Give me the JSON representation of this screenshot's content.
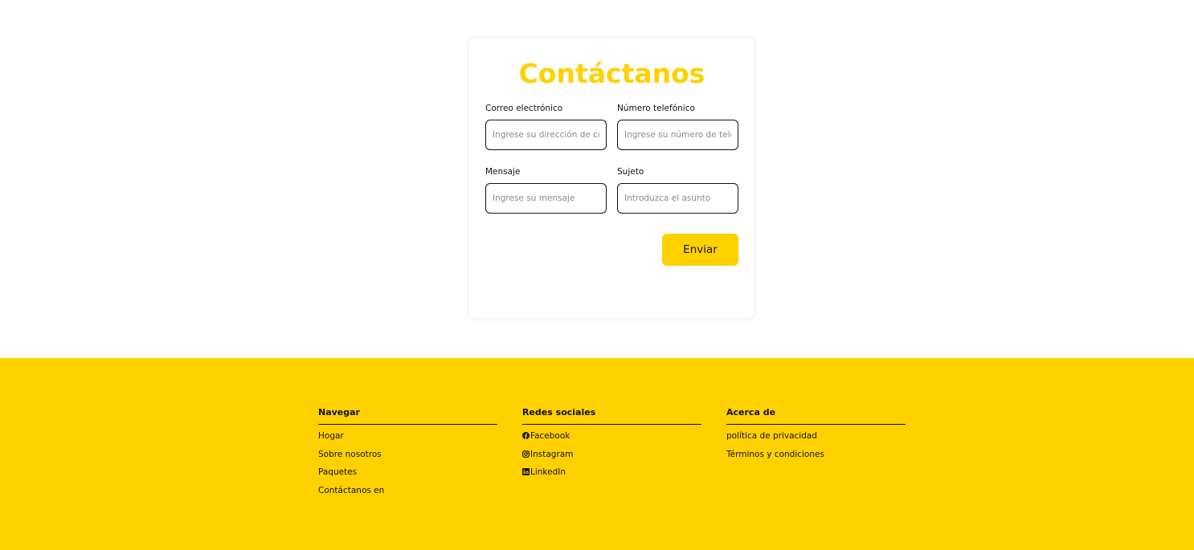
{
  "contact": {
    "title": "Contáctanos",
    "email": {
      "label": "Correo electrónico",
      "placeholder": "Ingrese su dirección de correo electrónico",
      "value": ""
    },
    "phone": {
      "label": "Número telefónico",
      "placeholder": "Ingrese su número de teléfono",
      "value": ""
    },
    "message": {
      "label": "Mensaje",
      "placeholder": "Ingrese su mensaje",
      "value": ""
    },
    "subject": {
      "label": "Sujeto",
      "placeholder": "Introduzca el asunto",
      "value": ""
    },
    "submit_label": "Enviar"
  },
  "footer": {
    "navigate": {
      "heading": "Navegar",
      "links": [
        {
          "label": "Hogar"
        },
        {
          "label": "Sobre nosotros"
        },
        {
          "label": "Paquetes"
        },
        {
          "label": "Contáctanos en"
        }
      ]
    },
    "social": {
      "heading": "Redes sociales",
      "links": [
        {
          "label": "Facebook",
          "icon": "facebook-icon"
        },
        {
          "label": "Instagram",
          "icon": "instagram-icon"
        },
        {
          "label": "LinkedIn",
          "icon": "linkedin-icon"
        }
      ]
    },
    "about": {
      "heading": "Acerca de",
      "links": [
        {
          "label": "política de privacidad"
        },
        {
          "label": "Términos y condiciones"
        }
      ]
    }
  },
  "colors": {
    "accent": "#ffd100",
    "text": "#111111",
    "placeholder": "#8a8a8a",
    "background": "#ffffff"
  }
}
